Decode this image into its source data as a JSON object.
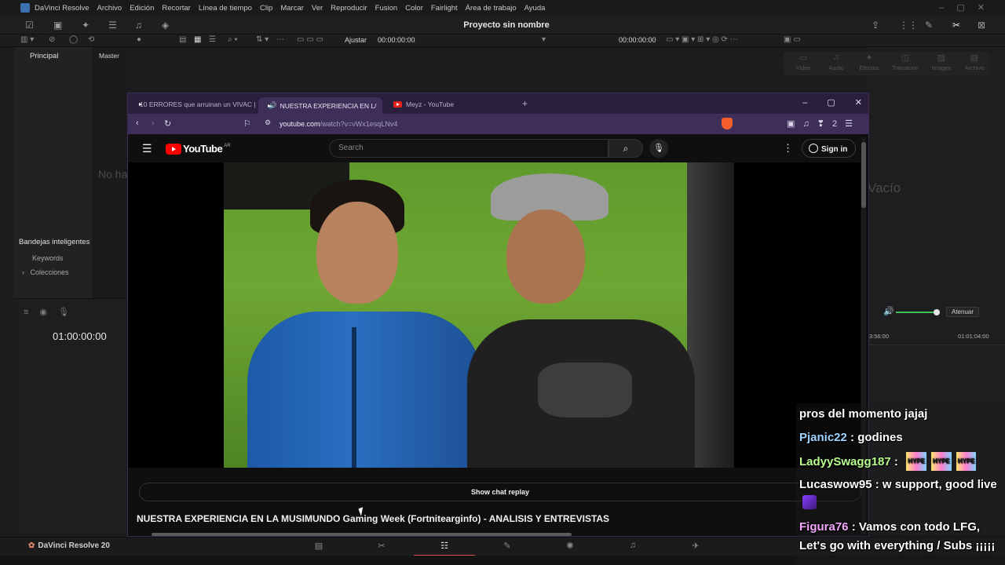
{
  "resolve": {
    "app_name": "DaVinci Resolve",
    "menu": [
      "Archivo",
      "Edición",
      "Recortar",
      "Línea de tiempo",
      "Clip",
      "Marcar",
      "Ver",
      "Reproducir",
      "Fusion",
      "Color",
      "Fairlight",
      "Área de trabajo",
      "Ayuda"
    ],
    "project_title": "Proyecto sin nombre",
    "zoom_label": "Ajustar",
    "timecode_source": "00:00:00:00",
    "timecode_record": "00:00:00:00",
    "sidebar": {
      "principal": "Principal",
      "master": "Master",
      "smart_bins": "Bandejas inteligentes",
      "keywords": "Keywords",
      "collections": "Colecciones"
    },
    "empty_left": "No ha",
    "empty_right": "Vacío",
    "timecode_left": "01:00:00:00",
    "media_tabs": [
      "Video",
      "Audio",
      "Efectos",
      "Transición",
      "Imagen",
      "Archivo"
    ],
    "atenuar": "Atenuar",
    "ruler_left": "3:56:00",
    "ruler_right": "01:01:04:00",
    "bottom_logo": "DaVinci Resolve 20",
    "page_icons": [
      "media-page-icon",
      "cut-page-icon",
      "edit-page-icon",
      "fusion-page-icon",
      "color-page-icon",
      "fairlight-page-icon",
      "deliver-page-icon"
    ],
    "active_page_index": 2
  },
  "browser": {
    "tabs": [
      {
        "title": "10 ERRORES que arruinan un VIVAC |",
        "active": false
      },
      {
        "title": "NUESTRA EXPERIENCIA EN L/",
        "active": true,
        "audio": true
      },
      {
        "title": "Meyz - YouTube",
        "active": false
      }
    ],
    "url_host": "youtube.com",
    "url_path": "/watch?v=vWx1esqLNv4",
    "extensions_count": "2"
  },
  "youtube": {
    "logo_text": "YouTube",
    "country": "AR",
    "search_placeholder": "Search",
    "sign_in": "Sign in",
    "show_chat_replay": "Show chat replay",
    "video_title": "NUESTRA EXPERIENCIA EN LA MUSIMUNDO Gaming Week (Fortnitearginfo) - ANALISIS Y ENTREVISTAS"
  },
  "chat": {
    "lines": [
      {
        "user": "",
        "message": "pros del momento jajaj",
        "color": "#ffffff"
      },
      {
        "user": "Pjanic22",
        "message": ": godines",
        "color": "#9fd3ff"
      },
      {
        "user": "LadyySwagg187",
        "message": ":",
        "color": "#b8ff8f",
        "badges": [
          "HYPE",
          "HYPE",
          "HYPE"
        ]
      },
      {
        "user": "Lucaswow95",
        "message": ": w support, good live",
        "color": "#ffffff"
      },
      {
        "user": "Figura76",
        "message": ": Vamos con todo LFG, Let's go with everything / Subs ¡¡¡¡¡",
        "color": "#f5a6ff"
      }
    ]
  }
}
